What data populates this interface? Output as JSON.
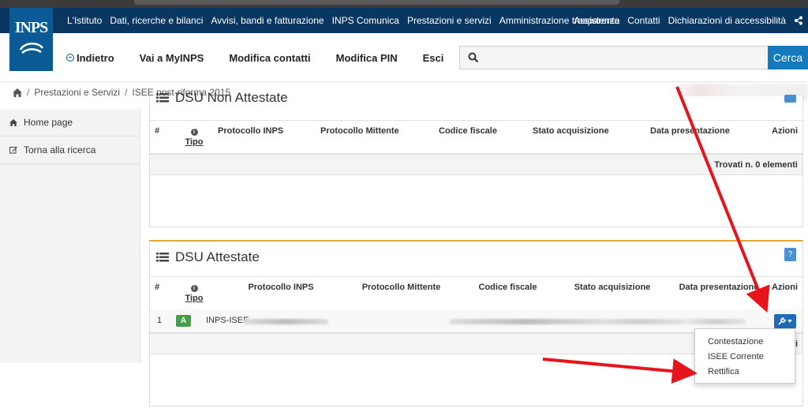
{
  "topbar": {
    "links": [
      "L'Istituto",
      "Dati, ricerche e bilanci",
      "Avvisi, bandi e fatturazione",
      "INPS Comunica",
      "Prestazioni e servizi",
      "Amministrazione trasparente"
    ],
    "right_links": [
      "Assistenza",
      "Contatti",
      "Dichiarazioni di accessibilità"
    ]
  },
  "logo": {
    "text": "INPS"
  },
  "header": {
    "menu": [
      "Indietro",
      "Vai a MyINPS",
      "Modifica contatti",
      "Modifica PIN",
      "Esci"
    ],
    "search_button": "Cerca",
    "search_placeholder": ""
  },
  "breadcrumb": [
    "Prestazioni e Servizi",
    "ISEE post-riforma 2015"
  ],
  "sidebar": {
    "items": [
      "Home page",
      "Torna alla ricerca"
    ]
  },
  "panel_non_attestate": {
    "title": "DSU Non Attestate",
    "columns": [
      "#",
      "Tipo",
      "Protocollo INPS",
      "Protocollo Mittente",
      "Codice fiscale",
      "Stato acquisizione",
      "Data presentazione",
      "Azioni"
    ],
    "count_text": "Trovati n. 0 elementi"
  },
  "panel_attestate": {
    "title": "DSU Attestate",
    "help": "?",
    "columns": [
      "#",
      "Tipo",
      "Protocollo INPS",
      "Protocollo Mittente",
      "Codice fiscale",
      "Stato acquisizione",
      "Data presentazione",
      "Azioni"
    ],
    "rows": [
      {
        "num": "1",
        "tipo": "A",
        "protocollo": "INPS-ISEE"
      }
    ],
    "count_suffix": "i"
  },
  "dropdown": {
    "items": [
      "Contestazione",
      "ISEE Corrente",
      "Rettifica"
    ]
  },
  "colors": {
    "topbar": "#0a3761",
    "accent": "#1579bd",
    "annotation_arrow": "#e8141b",
    "panel_accent": "#e6a838",
    "badge": "#42a047"
  }
}
